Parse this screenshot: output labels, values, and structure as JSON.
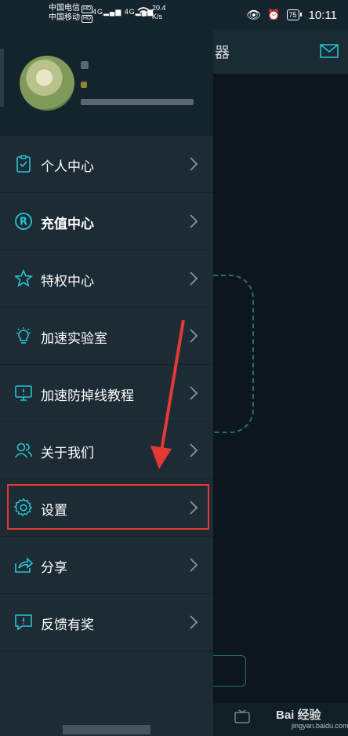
{
  "status_bar": {
    "carrier1": "中国电信",
    "carrier2": "中国移动",
    "hd": "HD",
    "network": "4G",
    "speed_value": "20.4",
    "speed_unit": "K/s",
    "battery": "75",
    "time": "10:11"
  },
  "background_app": {
    "title_fragment": "器",
    "watermark": "Bai 经验",
    "watermark_url": "jingyan.baidu.com"
  },
  "drawer": {
    "menu": [
      {
        "label": "个人中心",
        "icon": "clipboard-icon"
      },
      {
        "label": "充值中心",
        "icon": "recharge-r-icon"
      },
      {
        "label": "特权中心",
        "icon": "star-icon"
      },
      {
        "label": "加速实验室",
        "icon": "lightbulb-icon"
      },
      {
        "label": "加速防掉线教程",
        "icon": "monitor-icon"
      },
      {
        "label": "关于我们",
        "icon": "users-icon"
      },
      {
        "label": "设置",
        "icon": "gear-icon"
      },
      {
        "label": "分享",
        "icon": "share-icon"
      },
      {
        "label": "反馈有奖",
        "icon": "feedback-icon"
      }
    ]
  },
  "colors": {
    "accent": "#29c4d6",
    "drawer_bg": "#1c2b34",
    "highlight": "#e53935"
  }
}
